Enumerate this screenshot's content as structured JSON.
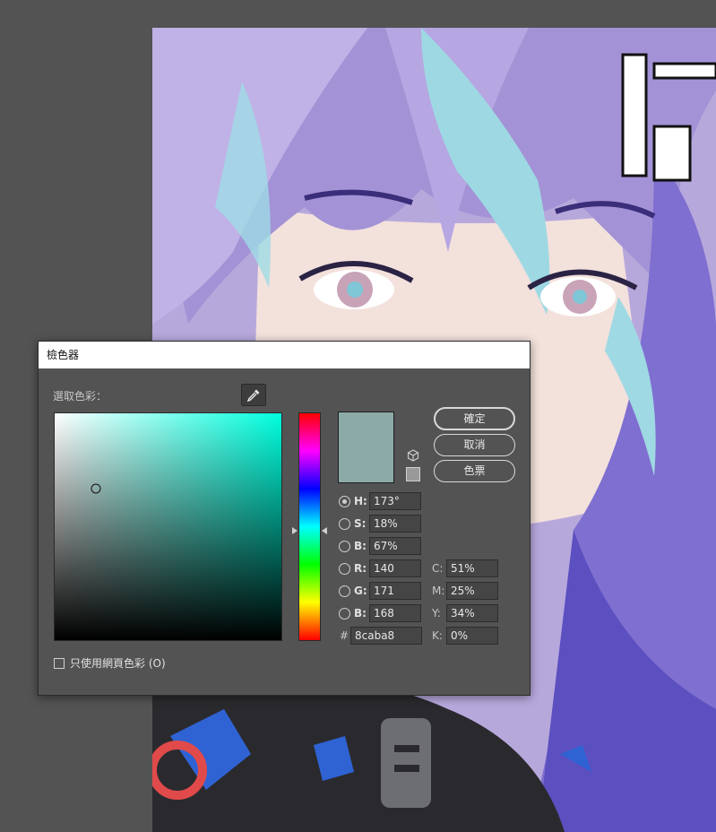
{
  "dialog": {
    "title": "檢色器",
    "select_label": "選取色彩：",
    "selected_color": "#8caba8",
    "hue_color": "#00ffde",
    "sv_marker": {
      "saturation": 0.18,
      "brightness": 0.67
    },
    "hue_fraction": 0.519,
    "buttons": {
      "ok": "確定",
      "cancel": "取消",
      "swatches": "色票"
    },
    "hsb": [
      {
        "label": "H:",
        "value": "173°",
        "selected": true
      },
      {
        "label": "S:",
        "value": "18%",
        "selected": false
      },
      {
        "label": "B:",
        "value": "67%",
        "selected": false
      }
    ],
    "rgb": [
      {
        "label": "R:",
        "value": "140",
        "selected": false
      },
      {
        "label": "G:",
        "value": "171",
        "selected": false
      },
      {
        "label": "B:",
        "value": "168",
        "selected": false
      }
    ],
    "cmyk": [
      {
        "label": "C:",
        "value": "51%"
      },
      {
        "label": "M:",
        "value": "25%"
      },
      {
        "label": "Y:",
        "value": "34%"
      },
      {
        "label": "K:",
        "value": "0%"
      }
    ],
    "hex": {
      "label": "#",
      "value": "8caba8"
    },
    "websafe_label": "只使用網頁色彩 (O)",
    "websafe_color": "#999999",
    "icons": {
      "eyedropper": "eyedropper-icon",
      "cube": "websafe-cube-icon"
    }
  }
}
